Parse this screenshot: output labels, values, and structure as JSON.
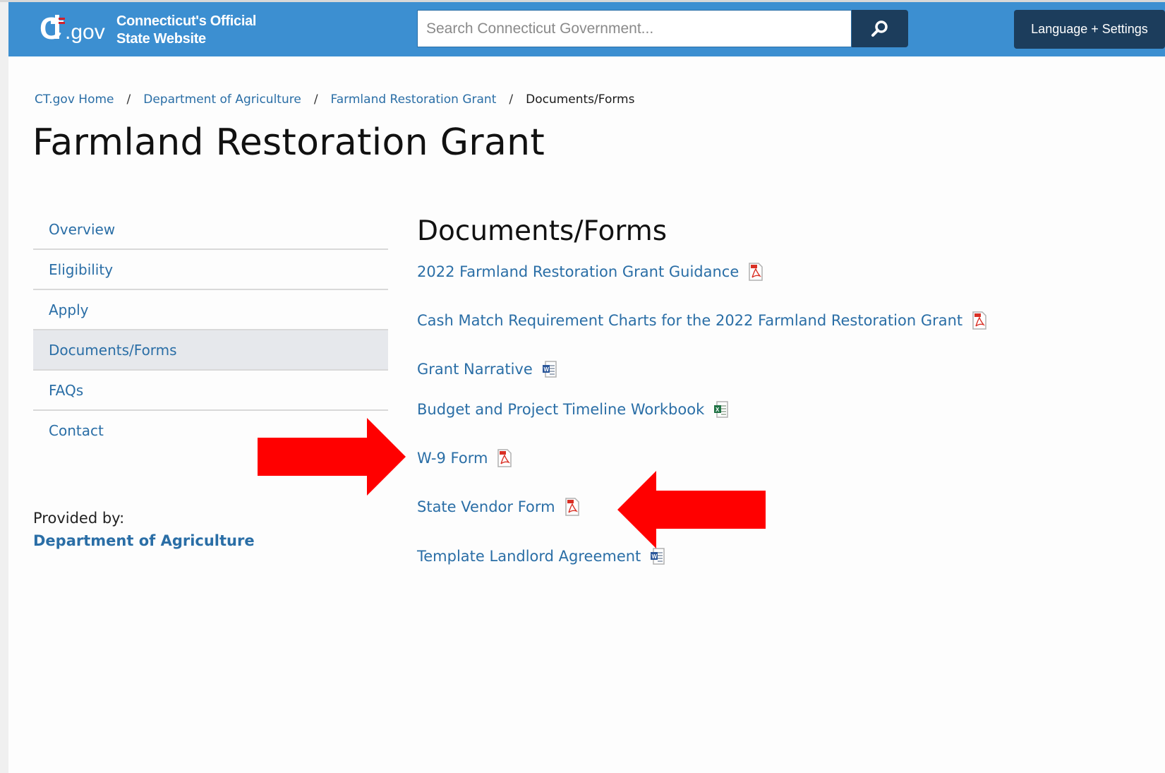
{
  "header": {
    "logo_text": "ct.gov",
    "site_title_line1": "Connecticut's Official",
    "site_title_line2": "State Website",
    "search_placeholder": "Search Connecticut Government...",
    "language_button": "Language + Settings",
    "colors": {
      "header_bg": "#3c8fd1",
      "button_bg": "#1c3d5c"
    }
  },
  "breadcrumb": {
    "items": [
      "CT.gov Home",
      "Department of Agriculture",
      "Farmland Restoration Grant"
    ],
    "current": "Documents/Forms",
    "separator": "/"
  },
  "page": {
    "title": "Farmland Restoration Grant"
  },
  "sidebar": {
    "items": [
      {
        "label": "Overview",
        "active": false
      },
      {
        "label": "Eligibility",
        "active": false
      },
      {
        "label": "Apply",
        "active": false
      },
      {
        "label": "Documents/Forms",
        "active": true
      },
      {
        "label": "FAQs",
        "active": false
      },
      {
        "label": "Contact",
        "active": false
      }
    ],
    "provided_by_label": "Provided by:",
    "provided_by_link": "Department of Agriculture"
  },
  "main": {
    "section_title": "Documents/Forms",
    "documents": [
      {
        "label": "2022 Farmland Restoration Grant Guidance",
        "icon": "pdf-icon"
      },
      {
        "label": "Cash Match Requirement Charts for the 2022 Farmland Restoration Grant",
        "icon": "pdf-icon"
      },
      {
        "label": "Grant Narrative",
        "icon": "word-icon"
      },
      {
        "label": "Budget and Project Timeline Workbook",
        "icon": "excel-icon"
      },
      {
        "label": "W-9 Form",
        "icon": "pdf-icon"
      },
      {
        "label": "State Vendor Form",
        "icon": "pdf-icon"
      },
      {
        "label": "Template Landlord Agreement",
        "icon": "word-icon"
      }
    ]
  },
  "annotations": {
    "arrow_color": "#ff0000"
  }
}
